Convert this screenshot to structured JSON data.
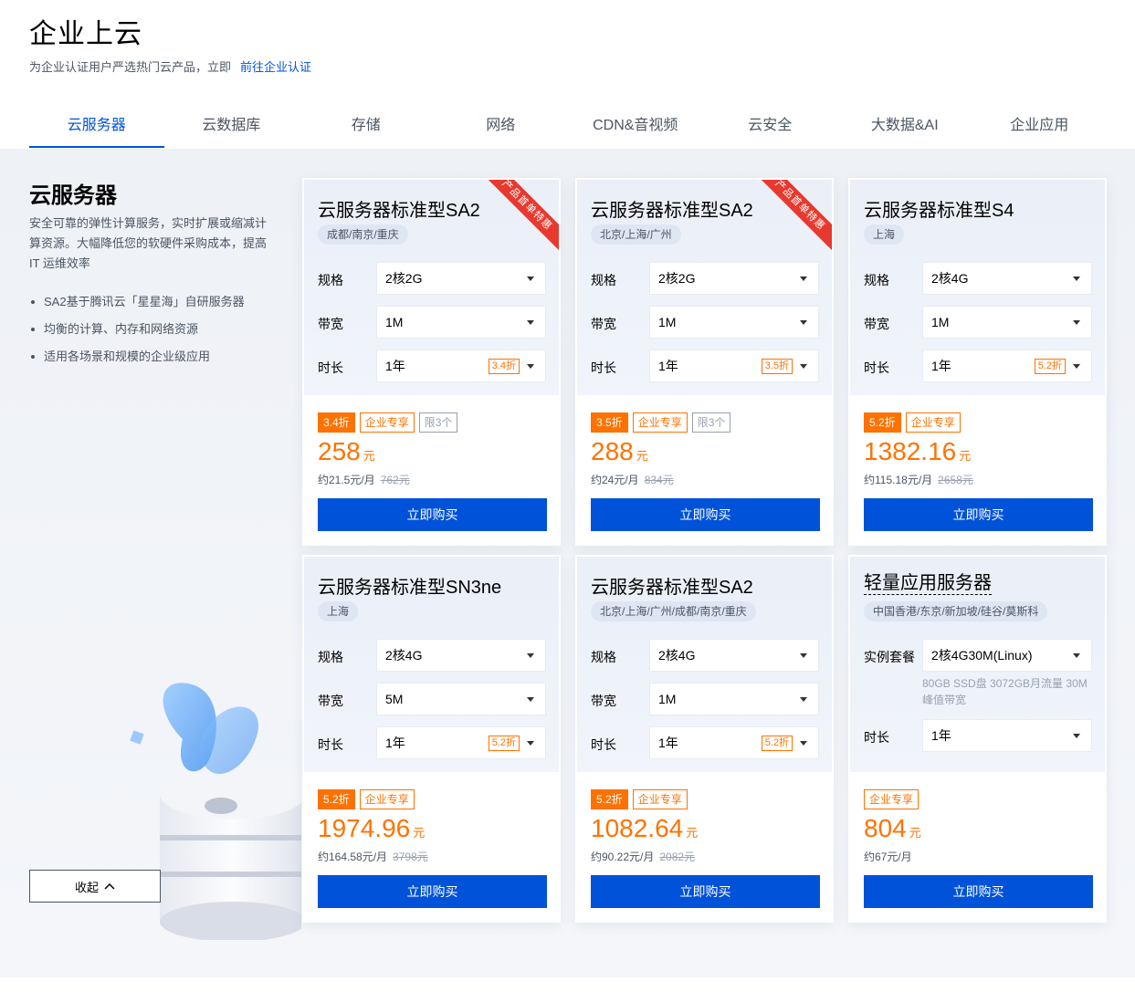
{
  "header": {
    "title": "企业上云",
    "subtitle": "为企业认证用户严选热门云产品，立即",
    "subtitle_link": "前往企业认证"
  },
  "tabs": [
    "云服务器",
    "云数据库",
    "存储",
    "网络",
    "CDN&音视频",
    "云安全",
    "大数据&AI",
    "企业应用"
  ],
  "intro": {
    "title": "云服务器",
    "desc": "安全可靠的弹性计算服务，实时扩展或缩减计算资源。大幅降低您的软硬件采购成本，提高 IT 运维效率",
    "bullets": [
      "SA2基于腾讯云「星星海」自研服务器",
      "均衡的计算、内存和网络资源",
      "适用各场景和规模的企业级应用"
    ],
    "collapse": "收起"
  },
  "labels": {
    "spec": "规格",
    "bandwidth": "带宽",
    "duration": "时长",
    "package": "实例套餐",
    "buy": "立即购买"
  },
  "colors": {
    "primary": "#0052d9",
    "accent": "#ff7200",
    "ribbon": "#e8392e"
  },
  "cards": [
    {
      "name": "云服务器标准型SA2",
      "ribbon": "产品首单特惠",
      "region": "成都/南京/重庆",
      "spec": "2核2G",
      "bandwidth": "1M",
      "duration": "1年",
      "duration_disc": "3.4折",
      "badge_disc": "3.4折",
      "badge_ent": "企业专享",
      "badge_limit": "限3个",
      "price": "258",
      "unit": "元",
      "monthly": "约21.5元/月",
      "orig": "762元"
    },
    {
      "name": "云服务器标准型SA2",
      "ribbon": "产品首单特惠",
      "region": "北京/上海/广州",
      "spec": "2核2G",
      "bandwidth": "1M",
      "duration": "1年",
      "duration_disc": "3.5折",
      "badge_disc": "3.5折",
      "badge_ent": "企业专享",
      "badge_limit": "限3个",
      "price": "288",
      "unit": "元",
      "monthly": "约24元/月",
      "orig": "834元"
    },
    {
      "name": "云服务器标准型S4",
      "region": "上海",
      "spec": "2核4G",
      "bandwidth": "1M",
      "duration": "1年",
      "duration_disc": "5.2折",
      "badge_disc": "5.2折",
      "badge_ent": "企业专享",
      "price": "1382.16",
      "unit": "元",
      "monthly": "约115.18元/月",
      "orig": "2658元"
    },
    {
      "name": "云服务器标准型SN3ne",
      "region": "上海",
      "spec": "2核4G",
      "bandwidth": "5M",
      "duration": "1年",
      "duration_disc": "5.2折",
      "badge_disc": "5.2折",
      "badge_ent": "企业专享",
      "price": "1974.96",
      "unit": "元",
      "monthly": "约164.58元/月",
      "orig": "3798元"
    },
    {
      "name": "云服务器标准型SA2",
      "region": "北京/上海/广州/成都/南京/重庆",
      "spec": "2核4G",
      "bandwidth": "1M",
      "duration": "1年",
      "duration_disc": "5.2折",
      "badge_disc": "5.2折",
      "badge_ent": "企业专享",
      "price": "1082.64",
      "unit": "元",
      "monthly": "约90.22元/月",
      "orig": "2082元"
    },
    {
      "name": "轻量应用服务器",
      "region": "中国香港/东京/新加坡/硅谷/莫斯科",
      "package": "2核4G30M(Linux)",
      "package_note": "80GB SSD盘 3072GB月流量 30M峰值带宽",
      "duration": "1年",
      "badge_ent": "企业专享",
      "price": "804",
      "unit": "元",
      "monthly": "约67元/月"
    }
  ]
}
